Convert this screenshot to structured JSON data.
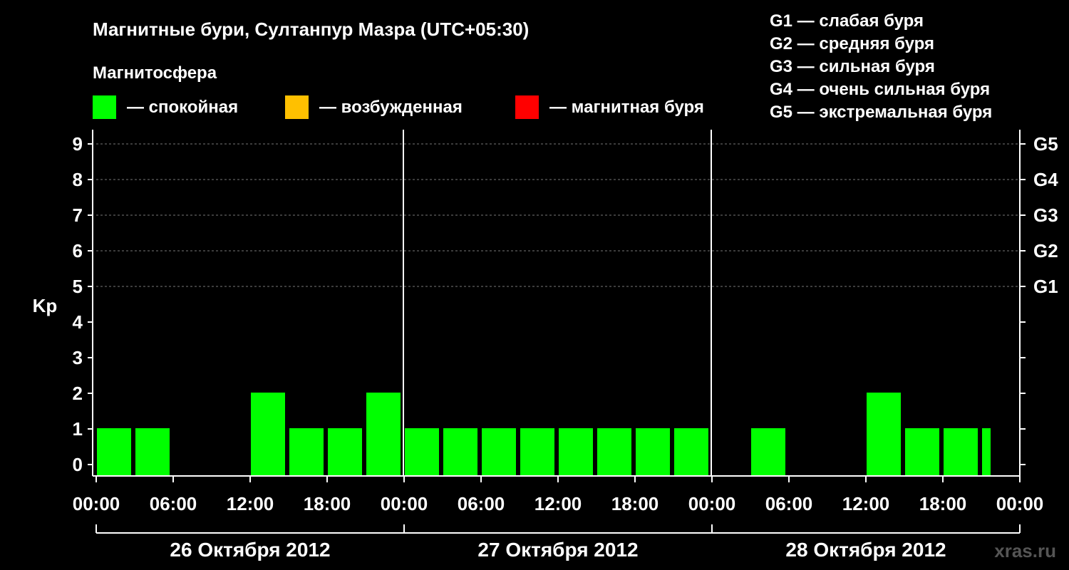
{
  "chart_data": {
    "type": "bar",
    "title": "Магнитные бури, Султанпур Мазра (UTC+05:30)",
    "ylabel": "Kp",
    "ylim": [
      0,
      9
    ],
    "y_ticks": [
      "0",
      "1",
      "2",
      "3",
      "4",
      "5",
      "6",
      "7",
      "8",
      "9"
    ],
    "right_ticks": [
      {
        "kp": 5,
        "label": "G1"
      },
      {
        "kp": 6,
        "label": "G2"
      },
      {
        "kp": 7,
        "label": "G3"
      },
      {
        "kp": 8,
        "label": "G4"
      },
      {
        "kp": 9,
        "label": "G5"
      }
    ],
    "x_ticks": [
      "00:00",
      "06:00",
      "12:00",
      "18:00",
      "00:00",
      "06:00",
      "12:00",
      "18:00",
      "00:00",
      "06:00",
      "12:00",
      "18:00",
      "00:00"
    ],
    "days": [
      "26 Октября 2012",
      "27 Октября 2012",
      "28 Октября 2012"
    ],
    "grid": true,
    "legend": {
      "heading": "Магнитосфера",
      "items": [
        {
          "label": "— спокойная",
          "color": "#00ff00"
        },
        {
          "label": "— возбужденная",
          "color": "#ffc000"
        },
        {
          "label": "— магнитная буря",
          "color": "#ff0000"
        }
      ]
    },
    "storm_scale": [
      "G1 — слабая буря",
      "G2 — средняя буря",
      "G3 — сильная буря",
      "G4 — очень сильная буря",
      "G5 — экстремальная буря"
    ],
    "series": [
      {
        "color": "#00ff00",
        "values": [
          1,
          1,
          0,
          0,
          2,
          1,
          1,
          2,
          1,
          1,
          1,
          1,
          1,
          1,
          1,
          1,
          0,
          1,
          0,
          0,
          2,
          1,
          1,
          1
        ]
      }
    ]
  },
  "watermark": "xras.ru"
}
